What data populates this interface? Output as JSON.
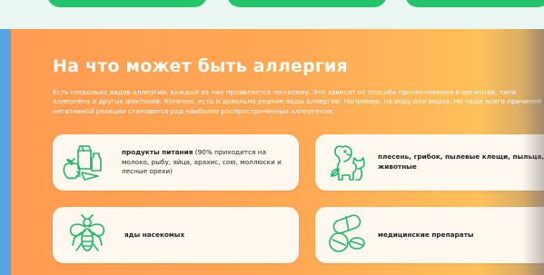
{
  "section": {
    "title": "На что может быть аллергия",
    "description": "Есть несколько видов аллергии, каждый из них проявляется по-своему. Это зависит от способа проникновения в организм, типа аллергена и других факторов. Конечно, есть и довольно редкие виды аллергии. Например, на воду или мороз. Но чаще всего причиной негативной реакции становится ряд наиболее распространенных аллергенов:"
  },
  "cards": [
    {
      "icon": "food-icon",
      "title": "продукты питания",
      "text": " (90% приходится на молоко, рыбу, яйца, арахис, сою, моллюски и лесные орехи)"
    },
    {
      "icon": "pets-icon",
      "title": "плесень, грибок, пылевые клещи, пыльца, животные",
      "text": ""
    },
    {
      "icon": "insect-icon",
      "title": "яды насекомых",
      "text": ""
    },
    {
      "icon": "pills-icon",
      "title": "медицинские препараты",
      "text": ""
    }
  ],
  "colors": {
    "green": "#23c46a",
    "orange": "#ff9b52",
    "card": "#fff8ef"
  }
}
